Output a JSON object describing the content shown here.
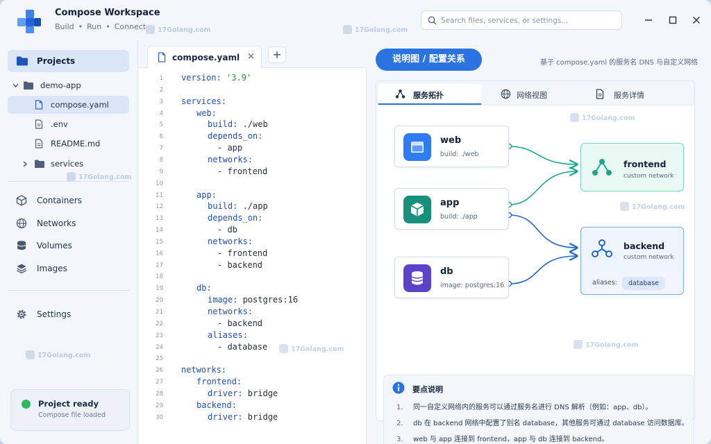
{
  "app": {
    "title": "Compose Workspace",
    "subtitle": [
      "Build",
      "•",
      "Run",
      "•",
      "Connect"
    ]
  },
  "search": {
    "placeholder": "Search files, services, or settings..."
  },
  "sidebar": {
    "projects_label": "Projects",
    "tree": {
      "root": "demo-app",
      "files": [
        "compose.yaml",
        ".env",
        "README.md"
      ],
      "folder": "services"
    },
    "nav": [
      "Containers",
      "Networks",
      "Volumes",
      "Images"
    ],
    "settings_label": "Settings",
    "status": {
      "title": "Project ready",
      "subtitle": "Compose file loaded",
      "color": "#2fb85c"
    }
  },
  "editor": {
    "tab_label": "compose.yaml",
    "close_glyph": "×",
    "plus_glyph": "+",
    "lines": [
      {
        "n": "1",
        "key": "version: ",
        "val": "'3.9'",
        "indent": 0
      },
      {
        "n": "2",
        "key": "",
        "val": "",
        "indent": 0
      },
      {
        "n": "3",
        "key": "services:",
        "val": "",
        "indent": 0
      },
      {
        "n": "4",
        "key": "web:",
        "val": "",
        "indent": 1
      },
      {
        "n": "5",
        "key": "build: ",
        "val": "./web",
        "indent": 2
      },
      {
        "n": "6",
        "key": "depends_on:",
        "val": "",
        "indent": 2
      },
      {
        "n": "7",
        "key": "",
        "val": "- app",
        "indent": 3
      },
      {
        "n": "8",
        "key": "networks:",
        "val": "",
        "indent": 2
      },
      {
        "n": "9",
        "key": "",
        "val": "- frontend",
        "indent": 3
      },
      {
        "n": "10",
        "key": "",
        "val": "",
        "indent": 0
      },
      {
        "n": "11",
        "key": "app:",
        "val": "",
        "indent": 1
      },
      {
        "n": "12",
        "key": "build: ",
        "val": "./app",
        "indent": 2
      },
      {
        "n": "13",
        "key": "depends_on:",
        "val": "",
        "indent": 2
      },
      {
        "n": "14",
        "key": "",
        "val": "- db",
        "indent": 3
      },
      {
        "n": "15",
        "key": "networks:",
        "val": "",
        "indent": 2
      },
      {
        "n": "16",
        "key": "",
        "val": "- frontend",
        "indent": 3
      },
      {
        "n": "17",
        "key": "",
        "val": "- backend",
        "indent": 3
      },
      {
        "n": "18",
        "key": "",
        "val": "",
        "indent": 0
      },
      {
        "n": "19",
        "key": "db:",
        "val": "",
        "indent": 1
      },
      {
        "n": "20",
        "key": "image: ",
        "val": "postgres:16",
        "indent": 2
      },
      {
        "n": "21",
        "key": "networks:",
        "val": "",
        "indent": 2
      },
      {
        "n": "22",
        "key": "",
        "val": "- backend",
        "indent": 3
      },
      {
        "n": "23",
        "key": "aliases:",
        "val": "",
        "indent": 2
      },
      {
        "n": "24",
        "key": "",
        "val": "- database",
        "indent": 3
      },
      {
        "n": "25",
        "key": "",
        "val": "",
        "indent": 0
      },
      {
        "n": "26",
        "key": "networks:",
        "val": "",
        "indent": 0
      },
      {
        "n": "27",
        "key": "frontend:",
        "val": "",
        "indent": 1
      },
      {
        "n": "28",
        "key": "driver: ",
        "val": "bridge",
        "indent": 2
      },
      {
        "n": "29",
        "key": "backend:",
        "val": "",
        "indent": 1
      },
      {
        "n": "30",
        "key": "driver: ",
        "val": "bridge",
        "indent": 2
      }
    ]
  },
  "panel": {
    "pill_label": "说明图 / 配置关系",
    "note": "基于 compose.yaml 的服务名 DNS 与自定义网络",
    "tabs": [
      "服务拓扑",
      "网络视图",
      "服务详情"
    ],
    "services": [
      {
        "name": "web",
        "meta": "build: ./web",
        "color": "#2f7bf0"
      },
      {
        "name": "app",
        "meta": "build: ./app",
        "color": "#17907c"
      },
      {
        "name": "db",
        "meta": "image: postgres:16",
        "color": "#5a43c9"
      }
    ],
    "networks": [
      {
        "name": "frontend",
        "meta": "custom network",
        "color": "#1aa58c"
      },
      {
        "name": "backend",
        "meta": "custom network",
        "color": "#2166c8",
        "aliases_label": "aliases:",
        "alias": "database"
      }
    ],
    "notes": {
      "title": "要点说明",
      "items": [
        {
          "num": "1.",
          "text": "同一自定义网络内的服务可以通过服务名进行 DNS 解析（例如：app、db）。"
        },
        {
          "num": "2.",
          "text": "db 在 backend 网络中配置了别名 database，其他服务可通过 database 访问数据库。"
        },
        {
          "num": "3.",
          "text": "web 与 app 连接到 frontend，app 与 db 连接到 backend。"
        }
      ]
    }
  },
  "watermark": "17Golang.com"
}
